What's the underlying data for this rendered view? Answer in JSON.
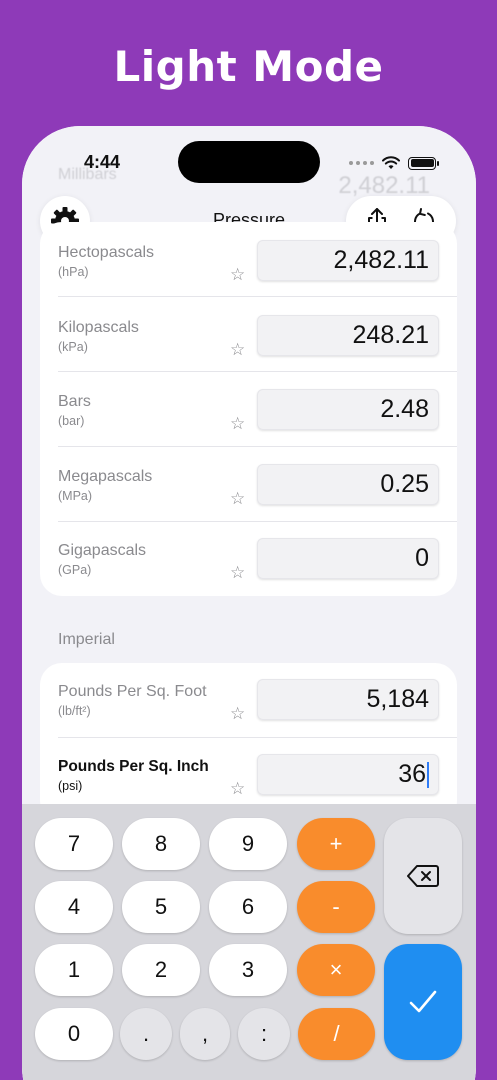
{
  "headline": "Light Mode",
  "status": {
    "time": "4:44"
  },
  "ghost": {
    "label": "Millibars",
    "value": "2,482.11"
  },
  "nav": {
    "title": "Pressure",
    "gear": "gear-icon",
    "share": "share-icon",
    "reset": "reset-icon"
  },
  "metric_rows": [
    {
      "name": "Hectopascals",
      "unit": "(hPa)",
      "value": "2,482.11"
    },
    {
      "name": "Kilopascals",
      "unit": "(kPa)",
      "value": "248.21"
    },
    {
      "name": "Bars",
      "unit": "(bar)",
      "value": "2.48"
    },
    {
      "name": "Megapascals",
      "unit": "(MPa)",
      "value": "0.25"
    },
    {
      "name": "Gigapascals",
      "unit": "(GPa)",
      "value": "0"
    }
  ],
  "imperial": {
    "header": "Imperial",
    "rows": [
      {
        "name": "Pounds Per Sq. Foot",
        "unit": "(lb/ft²)",
        "value": "5,184"
      },
      {
        "name": "Pounds Per Sq. Inch",
        "unit": "(psi)",
        "value": "36"
      }
    ]
  },
  "star_glyph": "☆",
  "keypad": {
    "keys": [
      "7",
      "8",
      "9",
      "+",
      "4",
      "5",
      "6",
      "-",
      "1",
      "2",
      "3",
      "×",
      "0",
      ".",
      ",",
      ":",
      "/"
    ],
    "backspace_icon": "backspace-icon",
    "done_icon": "checkmark-icon"
  },
  "colors": {
    "background": "#8e3ab8",
    "accent_orange": "#f98c2c",
    "accent_blue": "#1f8ef1"
  }
}
